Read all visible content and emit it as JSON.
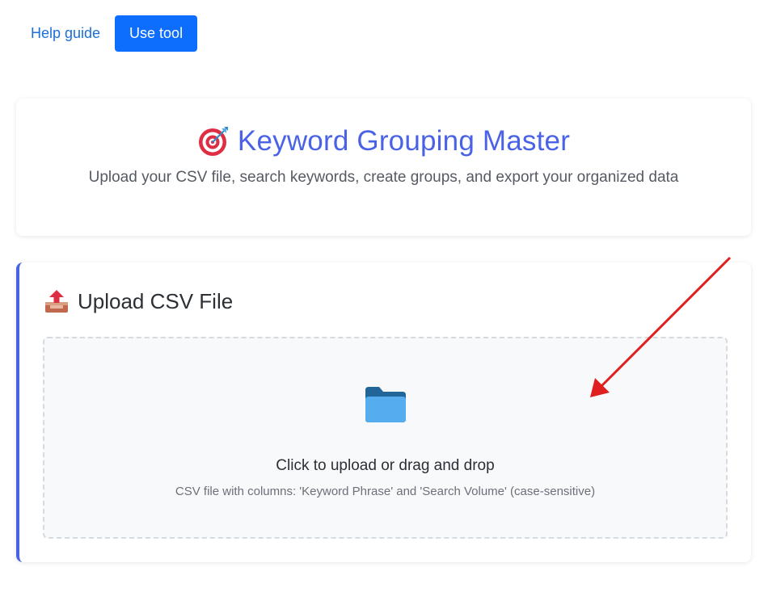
{
  "nav": {
    "help_label": "Help guide",
    "use_tool_label": "Use tool"
  },
  "header": {
    "title_icon": "target-icon",
    "title": "Keyword Grouping Master",
    "subtitle": "Upload your CSV file, search keywords, create groups, and export your organized data"
  },
  "upload": {
    "heading_icon": "outbox-tray-icon",
    "heading": "Upload CSV File",
    "dropzone_icon": "folder-icon",
    "dropzone_main": "Click to upload or drag and drop",
    "dropzone_sub": "CSV file with columns: 'Keyword Phrase' and 'Search Volume' (case-sensitive)"
  },
  "colors": {
    "accent": "#4a63e6",
    "primary_button": "#0d6efd",
    "link": "#1a6fd8",
    "annotation_arrow": "#e02020"
  }
}
